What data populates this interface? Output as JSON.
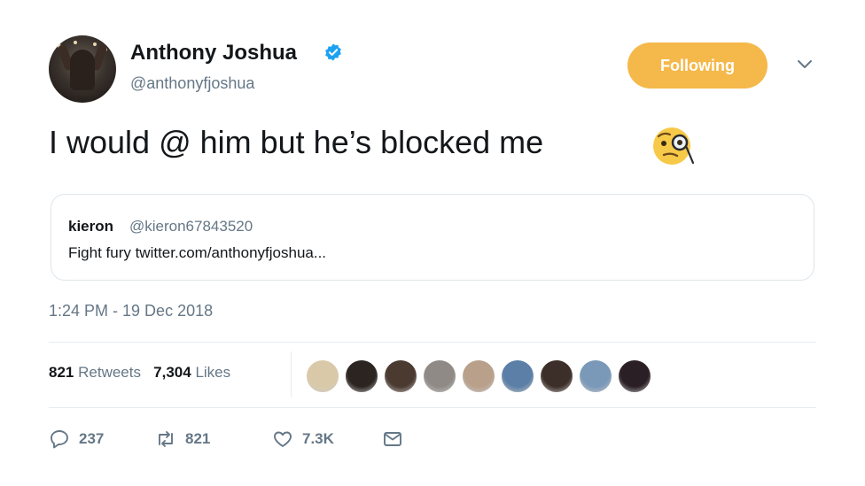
{
  "author": {
    "name": "Anthony Joshua",
    "handle": "@anthonyfjoshua",
    "verified_icon": "verified-badge-icon"
  },
  "follow_button": {
    "label": "Following",
    "color": "#f5b84a"
  },
  "menu_icon": "chevron-down-icon",
  "tweet": {
    "text": "I would @ him but he’s blocked me",
    "emoji": "face-with-monocle-emoji"
  },
  "quoted_tweet": {
    "name": "kieron",
    "handle": "@kieron67843520",
    "text": "Fight fury twitter.com/anthonyfjoshua..."
  },
  "timestamp": "1:24 PM - 19 Dec 2018",
  "stats": {
    "retweets_count": "821",
    "retweets_label": "Retweets",
    "likes_count": "7,304",
    "likes_label": "Likes"
  },
  "likers": [
    {
      "color": "#d9c9a8"
    },
    {
      "color": "#2b2420"
    },
    {
      "color": "#4a3a30"
    },
    {
      "color": "#8f8a86"
    },
    {
      "color": "#b8a08a"
    },
    {
      "color": "#5b7fa6"
    },
    {
      "color": "#3c2e28"
    },
    {
      "color": "#7a98b8"
    },
    {
      "color": "#2a1f24"
    }
  ],
  "actions": {
    "reply_count": "237",
    "retweet_count": "821",
    "like_count": "7.3K"
  },
  "colors": {
    "text_primary": "#14171a",
    "text_secondary": "#657786",
    "border": "#e6ecf0",
    "verified_blue": "#1da1f2"
  }
}
